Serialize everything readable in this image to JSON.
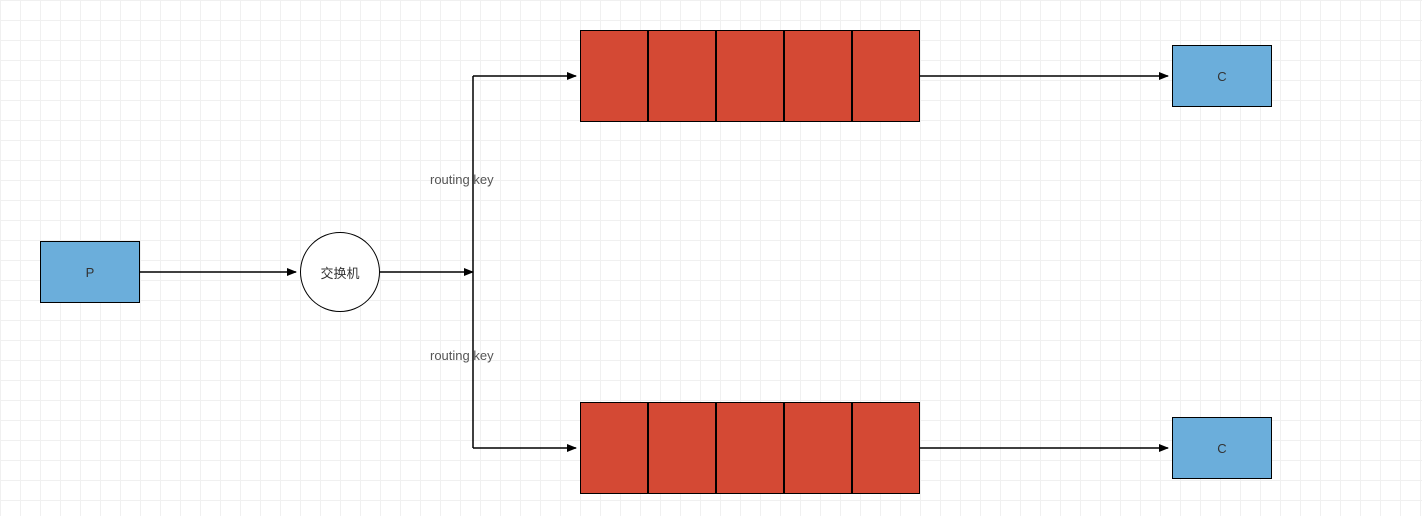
{
  "producer": {
    "label": "P"
  },
  "exchange": {
    "label": "交换机"
  },
  "routing": {
    "top_label": "routing key",
    "bottom_label": "routing key"
  },
  "queue_top": {
    "slots": 5
  },
  "queue_bottom": {
    "slots": 5
  },
  "consumer_top": {
    "label": "C"
  },
  "consumer_bottom": {
    "label": "C"
  },
  "colors": {
    "node_blue": "#6baedb",
    "queue_red": "#d44934",
    "line": "#000000",
    "grid": "#f0f0f0"
  }
}
